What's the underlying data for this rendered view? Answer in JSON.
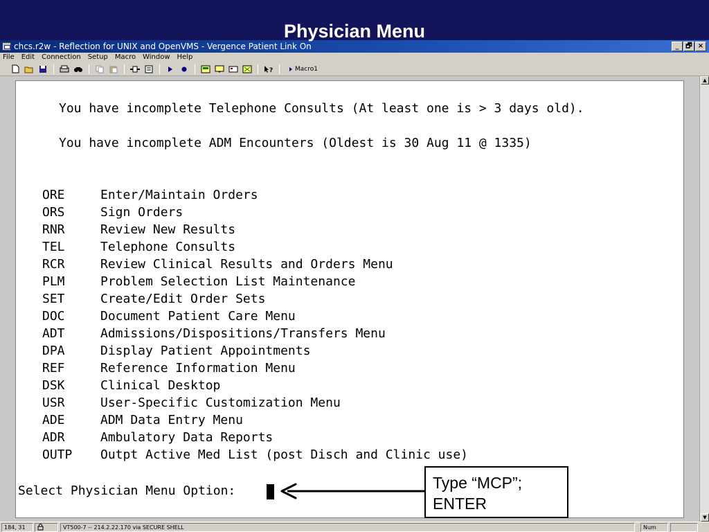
{
  "slide": {
    "title": "Physician Menu"
  },
  "window": {
    "title": "chcs.r2w - Reflection for UNIX and OpenVMS - Vergence Patient Link On",
    "controls": {
      "minimize": "_",
      "restore": "🗗",
      "close": "×"
    }
  },
  "menubar": {
    "items": [
      {
        "label": "File"
      },
      {
        "label": "Edit"
      },
      {
        "label": "Connection"
      },
      {
        "label": "Setup"
      },
      {
        "label": "Macro"
      },
      {
        "label": "Window"
      },
      {
        "label": "Help"
      }
    ]
  },
  "toolbar": {
    "icons": [
      "new-icon",
      "open-icon",
      "save-icon",
      "print-icon",
      "find-icon",
      "copy-icon",
      "paste-icon",
      "connect-icon",
      "transfer-icon",
      "play-icon",
      "record-icon",
      "settings-icon",
      "display-icon",
      "keyboard-icon",
      "macro-icon",
      "help-icon"
    ],
    "macro_label": "Macro1"
  },
  "terminal": {
    "notice_telephone": "You have incomplete Telephone Consults (At least one is > 3 days old).",
    "notice_adm": "You have incomplete ADM Encounters (Oldest is 30 Aug 11 @ 1335)",
    "menu_options": [
      {
        "code": "ORE",
        "label": "Enter/Maintain Orders"
      },
      {
        "code": "ORS",
        "label": "Sign Orders"
      },
      {
        "code": "RNR",
        "label": "Review New Results"
      },
      {
        "code": "TEL",
        "label": "Telephone Consults"
      },
      {
        "code": "RCR",
        "label": "Review Clinical Results and Orders Menu"
      },
      {
        "code": "PLM",
        "label": "Problem Selection List Maintenance"
      },
      {
        "code": "SET",
        "label": "Create/Edit Order Sets"
      },
      {
        "code": "DOC",
        "label": "Document Patient Care Menu"
      },
      {
        "code": "ADT",
        "label": "Admissions/Dispositions/Transfers Menu"
      },
      {
        "code": "DPA",
        "label": "Display Patient Appointments"
      },
      {
        "code": "REF",
        "label": "Reference Information Menu"
      },
      {
        "code": "DSK",
        "label": "Clinical Desktop"
      },
      {
        "code": "USR",
        "label": "User-Specific Customization Menu"
      },
      {
        "code": "ADE",
        "label": "ADM Data Entry Menu"
      },
      {
        "code": "ADR",
        "label": "Ambulatory Data Reports"
      },
      {
        "code": "OUTP",
        "label": "Outpt Active Med List (post Disch and Clinic use)"
      }
    ],
    "prompt": "Select Physician Menu Option:"
  },
  "statusbar": {
    "cursor_position": "184, 31",
    "connection": "VT500-7 -- 214.2.22.170 via SECURE SHELL",
    "num_lock": "Num"
  },
  "callout": {
    "line1": "Type “MCP”;",
    "line2": "ENTER"
  }
}
